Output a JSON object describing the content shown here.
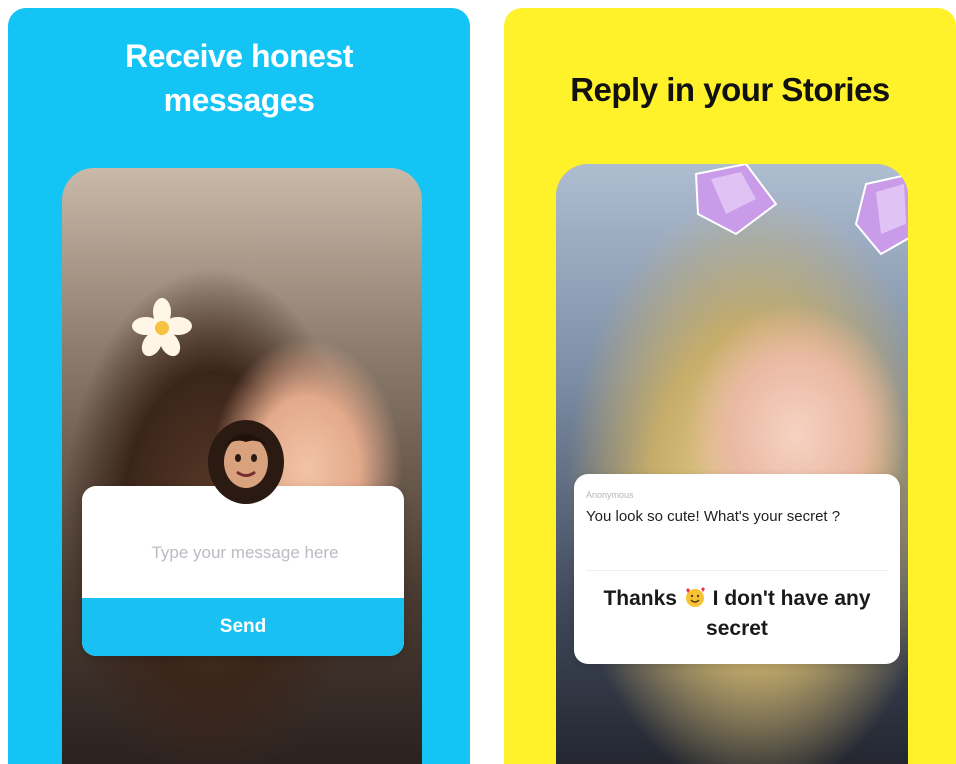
{
  "left_panel": {
    "headline_line1": "Receive honest",
    "headline_line2": "messages",
    "compose": {
      "placeholder": "Type your message here",
      "send_label": "Send"
    },
    "colors": {
      "background": "#14c4f4",
      "send_button": "#18c1f2"
    }
  },
  "right_panel": {
    "headline": "Reply in your Stories",
    "reply": {
      "sender": "Anonymous",
      "question": "You look so cute! What's your secret ?",
      "answer_before": "Thanks",
      "answer_after": "I don't have any secret",
      "emoji_icon": "smiling-face-with-hearts-icon"
    },
    "colors": {
      "background": "#fff22a"
    }
  }
}
